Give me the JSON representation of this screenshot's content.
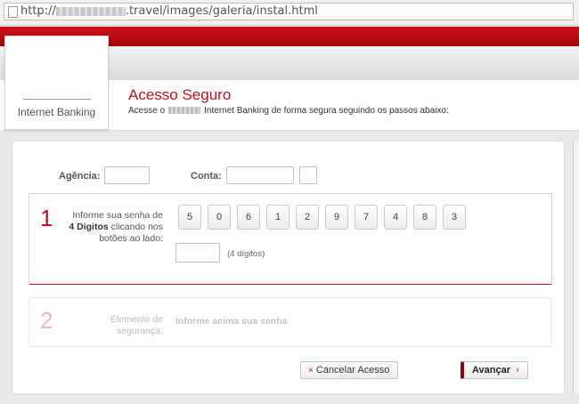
{
  "browser": {
    "url_prefix": "http://",
    "url_suffix": ".travel/images/galeria/instal.html"
  },
  "header": {
    "internet_banking_label": "Internet Banking",
    "title": "Acesso Seguro",
    "subtitle_before": "Acesse o",
    "subtitle_after": "Internet Banking de forma segura seguindo os passos abaixo:"
  },
  "login": {
    "agencia_label": "Agência:",
    "agencia_value": "",
    "conta_label": "Conta:",
    "conta_value": "",
    "digito_value": ""
  },
  "step1": {
    "number": "1",
    "text_line1": "Informe sua senha de",
    "text_bold": "4 Digitos",
    "text_line2_rest": "clicando nos",
    "text_line3": "botões ao lado:",
    "digits": [
      "5",
      "0",
      "6",
      "1",
      "2",
      "9",
      "7",
      "4",
      "8",
      "3"
    ],
    "pin_value": "",
    "pin_hint": "(4 dígitos)"
  },
  "step2": {
    "number": "2",
    "label_line1": "Elemento de",
    "label_line2": "segurança:",
    "inform_text": "Informe acima sua senha"
  },
  "actions": {
    "cancel_icon": "×",
    "cancel_label": "Cancelar Acesso",
    "next_label": "Avançar",
    "next_icon": "›"
  },
  "colors": {
    "brand_red": "#c1121c",
    "dark_red": "#8c0a12"
  }
}
